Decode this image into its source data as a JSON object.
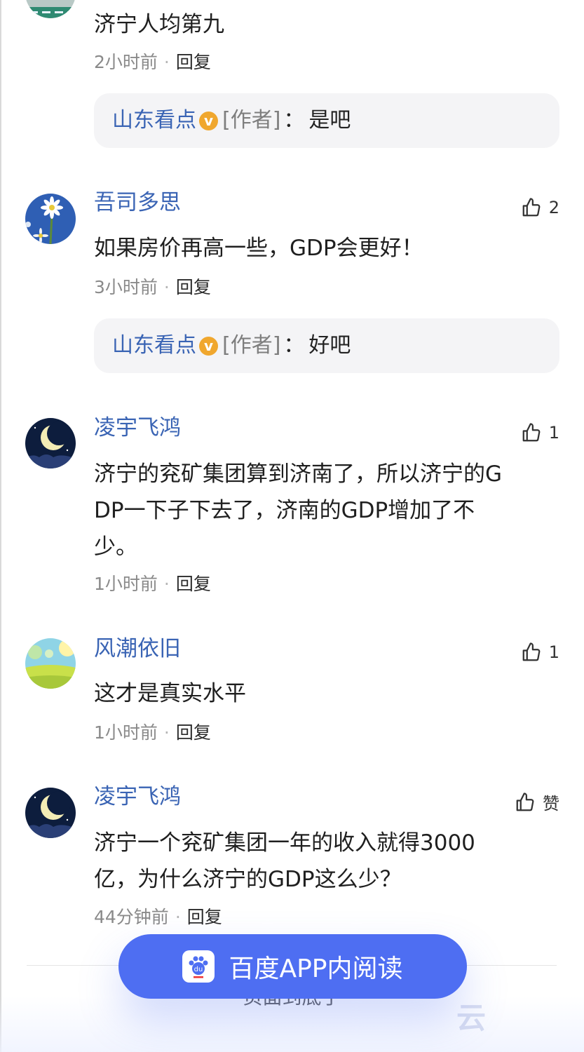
{
  "comments": [
    {
      "text": "济宁人均第九",
      "time": "2小时前",
      "reply": "回复",
      "author_reply": {
        "name": "山东看点",
        "badge": "v",
        "tag": "[作者]",
        "colon": "：",
        "text": "是吧"
      }
    },
    {
      "user": "吾司多思",
      "likes": "2",
      "lines": [
        "如果房价再高一些，GDP会更好！"
      ],
      "time": "3小时前",
      "reply": "回复",
      "author_reply": {
        "name": "山东看点",
        "badge": "v",
        "tag": "[作者]",
        "colon": "：",
        "text": "好吧"
      }
    },
    {
      "user": "凌宇飞鸿",
      "likes": "1",
      "lines": [
        "济宁的兖矿集团算到济南了，所以济宁的G",
        "DP一下子下去了，济南的GDP增加了不",
        "少。"
      ],
      "time": "1小时前",
      "reply": "回复"
    },
    {
      "user": "风潮依旧",
      "likes": "1",
      "lines": [
        "这才是真实水平"
      ],
      "time": "1小时前",
      "reply": "回复"
    },
    {
      "user": "凌宇飞鸿",
      "likes": "赞",
      "lines": [
        "济宁一个兖矿集团一年的收入就得3000",
        "亿，为什么济宁的GDP这么少？"
      ],
      "time": "44分钟前",
      "reply": "回复"
    }
  ],
  "read_button": {
    "label": "百度APP内阅读",
    "logo_text": "du"
  },
  "more_link": "页面到底了",
  "watermark": "云",
  "colors": {
    "username": "#3a64b4",
    "accent": "#4e6ef2",
    "badge": "#f0a72e"
  }
}
